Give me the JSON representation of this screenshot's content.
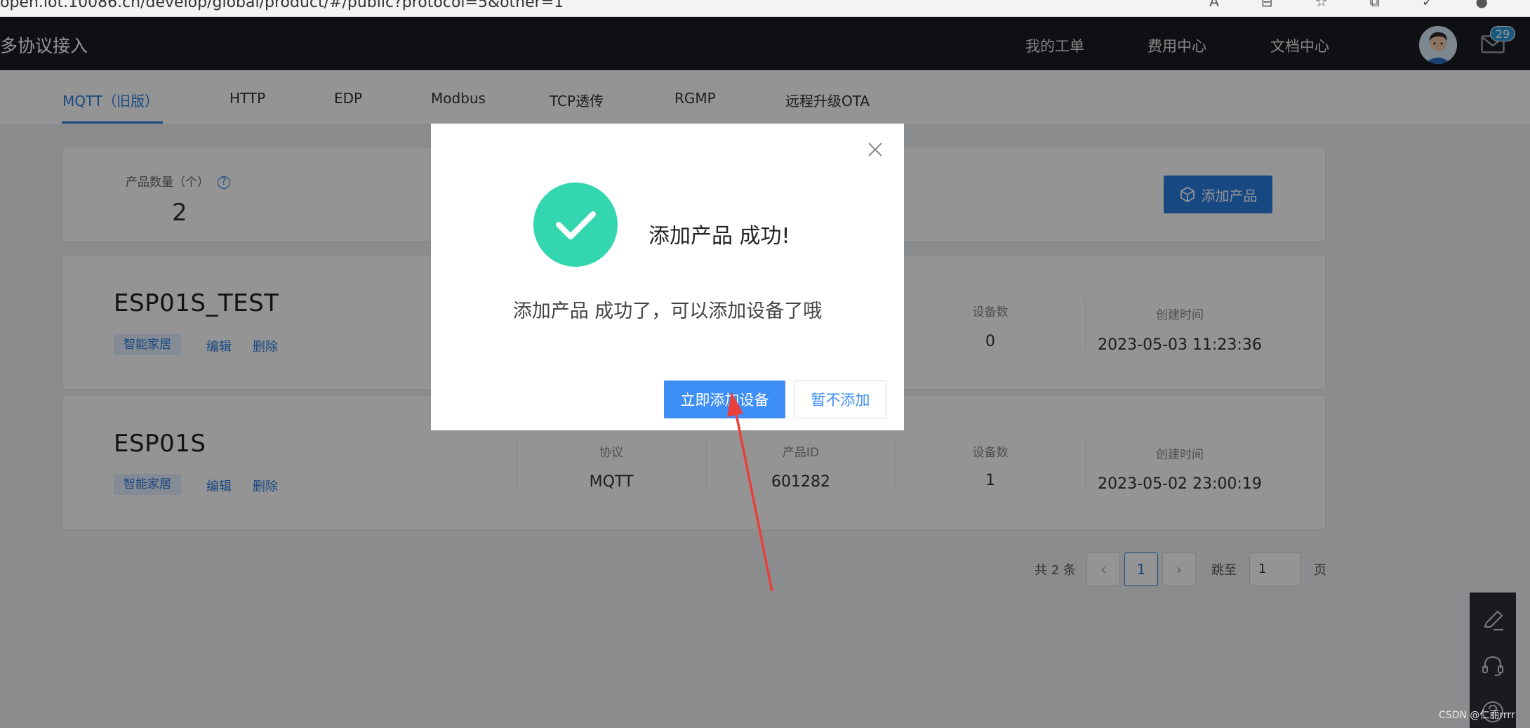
{
  "browser": {
    "url": "open.iot.10086.cn/develop/global/product/#/public?protocol=5&other=1"
  },
  "header": {
    "brand": "多协议接入",
    "nav": [
      "我的工单",
      "费用中心",
      "文档中心"
    ],
    "mail_count": "29"
  },
  "tabs": [
    "MQTT（旧版）",
    "HTTP",
    "EDP",
    "Modbus",
    "TCP透传",
    "RGMP",
    "远程升级OTA"
  ],
  "summary": {
    "label": "产品数量（个）",
    "help": "?",
    "value": "2",
    "add_button": "添加产品"
  },
  "products": [
    {
      "name": "ESP01S_TEST",
      "tag": "智能家居",
      "edit": "编辑",
      "delete": "删除",
      "device_label": "设备数",
      "device_count": "0",
      "created_label": "创建时间",
      "created": "2023-05-03 11:23:36"
    },
    {
      "name": "ESP01S",
      "tag": "智能家居",
      "edit": "编辑",
      "delete": "删除",
      "protocol_label": "协议",
      "protocol": "MQTT",
      "id_label": "产品ID",
      "id": "601282",
      "device_label": "设备数",
      "device_count": "1",
      "created_label": "创建时间",
      "created": "2023-05-02 23:00:19"
    }
  ],
  "pagination": {
    "total": "共 2 条",
    "prev": "‹",
    "page": "1",
    "next": "›",
    "goto_label": "跳至",
    "goto_value": "1",
    "page_suffix": "页"
  },
  "modal": {
    "title": "添加产品 成功!",
    "message": "添加产品 成功了，可以添加设备了哦",
    "primary": "立即添加设备",
    "secondary": "暂不添加"
  },
  "watermark": "CSDN @仁丽rrrr",
  "colors": {
    "accent": "#2a7de1",
    "success": "#34d6b0",
    "topbar": "#1b1d21",
    "annotation_arrow": "#e8403a"
  }
}
